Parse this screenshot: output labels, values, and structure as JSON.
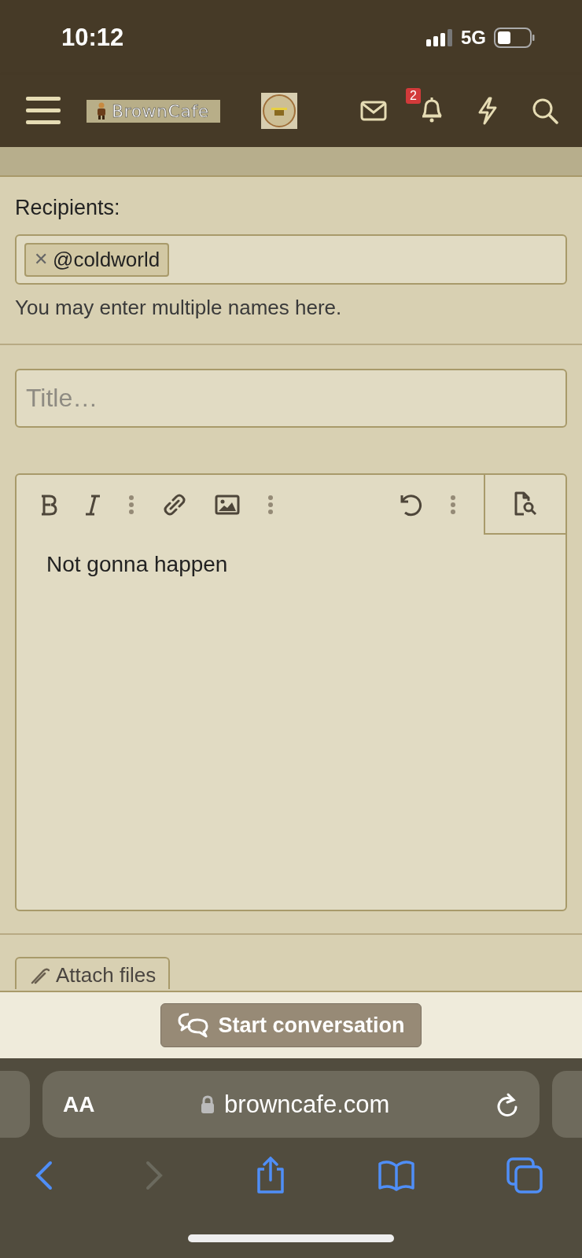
{
  "status_bar": {
    "time": "10:12",
    "network": "5G"
  },
  "header": {
    "logo_text": "BrownCafe",
    "notification_count": "2"
  },
  "recipients": {
    "label": "Recipients:",
    "tags": [
      {
        "text": "@coldworld",
        "remove": "✕"
      }
    ],
    "hint": "You may enter multiple names here."
  },
  "title_field": {
    "placeholder": "Title…"
  },
  "editor": {
    "toolbar": [
      {
        "kind": "bold"
      },
      {
        "kind": "italic"
      },
      {
        "kind": "more"
      },
      {
        "kind": "link"
      },
      {
        "kind": "image"
      },
      {
        "kind": "more"
      },
      {
        "kind": "spacer"
      },
      {
        "kind": "undo"
      },
      {
        "kind": "more"
      }
    ],
    "body": "Not gonna happen"
  },
  "attach_button": {
    "label": "Attach files"
  },
  "submit_button": {
    "label": "Start conversation"
  },
  "browser": {
    "text_size": "AA",
    "url": "browncafe.com"
  }
}
